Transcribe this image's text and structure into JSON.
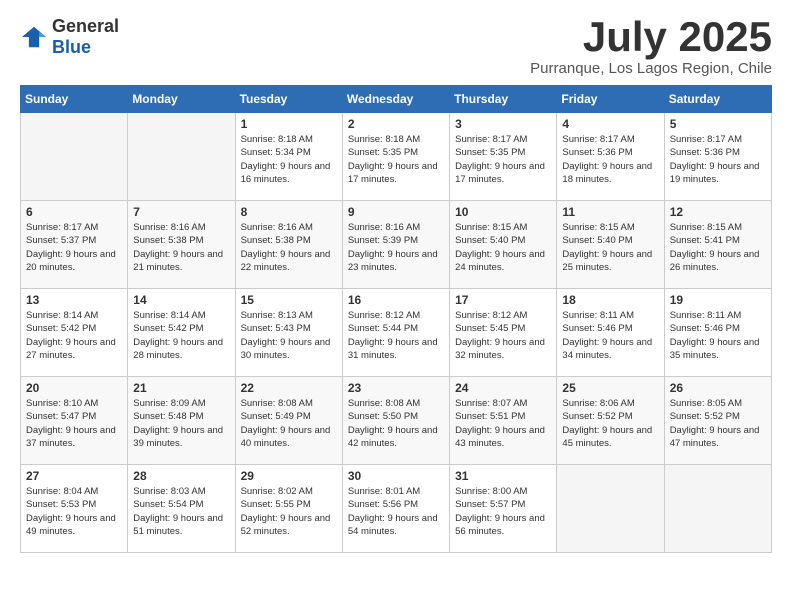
{
  "header": {
    "logo_general": "General",
    "logo_blue": "Blue",
    "month_title": "July 2025",
    "subtitle": "Purranque, Los Lagos Region, Chile"
  },
  "days_of_week": [
    "Sunday",
    "Monday",
    "Tuesday",
    "Wednesday",
    "Thursday",
    "Friday",
    "Saturday"
  ],
  "weeks": [
    [
      {
        "day": "",
        "empty": true
      },
      {
        "day": "",
        "empty": true
      },
      {
        "day": "1",
        "sunrise": "Sunrise: 8:18 AM",
        "sunset": "Sunset: 5:34 PM",
        "daylight": "Daylight: 9 hours and 16 minutes."
      },
      {
        "day": "2",
        "sunrise": "Sunrise: 8:18 AM",
        "sunset": "Sunset: 5:35 PM",
        "daylight": "Daylight: 9 hours and 17 minutes."
      },
      {
        "day": "3",
        "sunrise": "Sunrise: 8:17 AM",
        "sunset": "Sunset: 5:35 PM",
        "daylight": "Daylight: 9 hours and 17 minutes."
      },
      {
        "day": "4",
        "sunrise": "Sunrise: 8:17 AM",
        "sunset": "Sunset: 5:36 PM",
        "daylight": "Daylight: 9 hours and 18 minutes."
      },
      {
        "day": "5",
        "sunrise": "Sunrise: 8:17 AM",
        "sunset": "Sunset: 5:36 PM",
        "daylight": "Daylight: 9 hours and 19 minutes."
      }
    ],
    [
      {
        "day": "6",
        "sunrise": "Sunrise: 8:17 AM",
        "sunset": "Sunset: 5:37 PM",
        "daylight": "Daylight: 9 hours and 20 minutes."
      },
      {
        "day": "7",
        "sunrise": "Sunrise: 8:16 AM",
        "sunset": "Sunset: 5:38 PM",
        "daylight": "Daylight: 9 hours and 21 minutes."
      },
      {
        "day": "8",
        "sunrise": "Sunrise: 8:16 AM",
        "sunset": "Sunset: 5:38 PM",
        "daylight": "Daylight: 9 hours and 22 minutes."
      },
      {
        "day": "9",
        "sunrise": "Sunrise: 8:16 AM",
        "sunset": "Sunset: 5:39 PM",
        "daylight": "Daylight: 9 hours and 23 minutes."
      },
      {
        "day": "10",
        "sunrise": "Sunrise: 8:15 AM",
        "sunset": "Sunset: 5:40 PM",
        "daylight": "Daylight: 9 hours and 24 minutes."
      },
      {
        "day": "11",
        "sunrise": "Sunrise: 8:15 AM",
        "sunset": "Sunset: 5:40 PM",
        "daylight": "Daylight: 9 hours and 25 minutes."
      },
      {
        "day": "12",
        "sunrise": "Sunrise: 8:15 AM",
        "sunset": "Sunset: 5:41 PM",
        "daylight": "Daylight: 9 hours and 26 minutes."
      }
    ],
    [
      {
        "day": "13",
        "sunrise": "Sunrise: 8:14 AM",
        "sunset": "Sunset: 5:42 PM",
        "daylight": "Daylight: 9 hours and 27 minutes."
      },
      {
        "day": "14",
        "sunrise": "Sunrise: 8:14 AM",
        "sunset": "Sunset: 5:42 PM",
        "daylight": "Daylight: 9 hours and 28 minutes."
      },
      {
        "day": "15",
        "sunrise": "Sunrise: 8:13 AM",
        "sunset": "Sunset: 5:43 PM",
        "daylight": "Daylight: 9 hours and 30 minutes."
      },
      {
        "day": "16",
        "sunrise": "Sunrise: 8:12 AM",
        "sunset": "Sunset: 5:44 PM",
        "daylight": "Daylight: 9 hours and 31 minutes."
      },
      {
        "day": "17",
        "sunrise": "Sunrise: 8:12 AM",
        "sunset": "Sunset: 5:45 PM",
        "daylight": "Daylight: 9 hours and 32 minutes."
      },
      {
        "day": "18",
        "sunrise": "Sunrise: 8:11 AM",
        "sunset": "Sunset: 5:46 PM",
        "daylight": "Daylight: 9 hours and 34 minutes."
      },
      {
        "day": "19",
        "sunrise": "Sunrise: 8:11 AM",
        "sunset": "Sunset: 5:46 PM",
        "daylight": "Daylight: 9 hours and 35 minutes."
      }
    ],
    [
      {
        "day": "20",
        "sunrise": "Sunrise: 8:10 AM",
        "sunset": "Sunset: 5:47 PM",
        "daylight": "Daylight: 9 hours and 37 minutes."
      },
      {
        "day": "21",
        "sunrise": "Sunrise: 8:09 AM",
        "sunset": "Sunset: 5:48 PM",
        "daylight": "Daylight: 9 hours and 39 minutes."
      },
      {
        "day": "22",
        "sunrise": "Sunrise: 8:08 AM",
        "sunset": "Sunset: 5:49 PM",
        "daylight": "Daylight: 9 hours and 40 minutes."
      },
      {
        "day": "23",
        "sunrise": "Sunrise: 8:08 AM",
        "sunset": "Sunset: 5:50 PM",
        "daylight": "Daylight: 9 hours and 42 minutes."
      },
      {
        "day": "24",
        "sunrise": "Sunrise: 8:07 AM",
        "sunset": "Sunset: 5:51 PM",
        "daylight": "Daylight: 9 hours and 43 minutes."
      },
      {
        "day": "25",
        "sunrise": "Sunrise: 8:06 AM",
        "sunset": "Sunset: 5:52 PM",
        "daylight": "Daylight: 9 hours and 45 minutes."
      },
      {
        "day": "26",
        "sunrise": "Sunrise: 8:05 AM",
        "sunset": "Sunset: 5:52 PM",
        "daylight": "Daylight: 9 hours and 47 minutes."
      }
    ],
    [
      {
        "day": "27",
        "sunrise": "Sunrise: 8:04 AM",
        "sunset": "Sunset: 5:53 PM",
        "daylight": "Daylight: 9 hours and 49 minutes."
      },
      {
        "day": "28",
        "sunrise": "Sunrise: 8:03 AM",
        "sunset": "Sunset: 5:54 PM",
        "daylight": "Daylight: 9 hours and 51 minutes."
      },
      {
        "day": "29",
        "sunrise": "Sunrise: 8:02 AM",
        "sunset": "Sunset: 5:55 PM",
        "daylight": "Daylight: 9 hours and 52 minutes."
      },
      {
        "day": "30",
        "sunrise": "Sunrise: 8:01 AM",
        "sunset": "Sunset: 5:56 PM",
        "daylight": "Daylight: 9 hours and 54 minutes."
      },
      {
        "day": "31",
        "sunrise": "Sunrise: 8:00 AM",
        "sunset": "Sunset: 5:57 PM",
        "daylight": "Daylight: 9 hours and 56 minutes."
      },
      {
        "day": "",
        "empty": true
      },
      {
        "day": "",
        "empty": true
      }
    ]
  ]
}
